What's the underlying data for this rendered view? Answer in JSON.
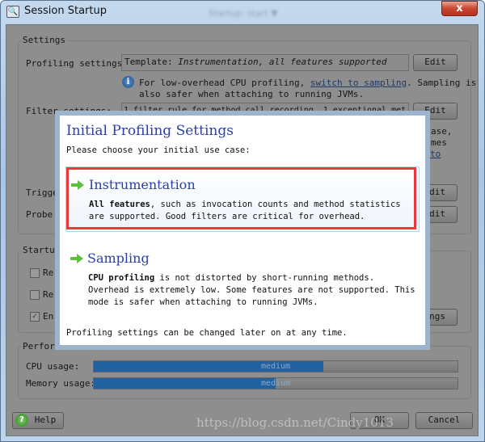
{
  "window": {
    "title": "Session Startup",
    "background_title": "Startup: start ▼",
    "close_label": "x"
  },
  "settings": {
    "group_label": "Settings",
    "profiling_label": "Profiling settings:",
    "profiling_value_prefix": "Template: ",
    "profiling_value_italic": "Instrumentation, all features supported",
    "edit_label": "Edit",
    "info_line1_before": "For low-overhead CPU profiling, ",
    "info_link": "switch to sampling",
    "info_line1_after": ". Sampling is",
    "info_line2": "also safer when attaching to running JVMs.",
    "filter_label": "Filter settings:",
    "filter_value": "1 filter rule for method call recording, 1 exceptional met",
    "partial_line1": "ase,",
    "partial_line2": "mes",
    "partial_link": "to",
    "trigger_label": "Trigge",
    "probe_label": "Probe",
    "edit_partial": "dit"
  },
  "startup": {
    "group_label": "Startup",
    "items": [
      {
        "label": "Re",
        "checked": false
      },
      {
        "label": "Re",
        "checked": false
      },
      {
        "label": "En",
        "checked": true
      }
    ],
    "button_partial": "ngs"
  },
  "performance": {
    "group_label": "Perform",
    "cpu_label": "CPU usage:",
    "cpu_value": "medium",
    "cpu_fraction": 0.63,
    "memory_label": "Memory usage:",
    "memory_value": "medium",
    "memory_fraction": 0.5,
    "bar_color": "#2261a0"
  },
  "footer": {
    "help_label": "Help",
    "ok_label": "OK",
    "cancel_label": "Cancel"
  },
  "modal": {
    "title": "Initial Profiling Settings",
    "prompt": "Please choose your initial use case:",
    "options": [
      {
        "title": "Instrumentation",
        "bold": "All features",
        "line1": ", such as invocation counts and method statistics",
        "line2": "are supported. Good filters are critical for overhead.",
        "selected": true
      },
      {
        "title": "Sampling",
        "bold": "CPU profiling",
        "line1": " is not distorted by short-running methods.",
        "line2": "Overhead is extremely low. Some features are not supported. This",
        "line3": "mode is safer when attaching to running JVMs.",
        "selected": false
      }
    ],
    "footer": "Profiling settings can be changed later on at any time.",
    "highlight_color": "#e83a3a"
  },
  "watermark": "https://blog.csdn.net/Cindy1013"
}
